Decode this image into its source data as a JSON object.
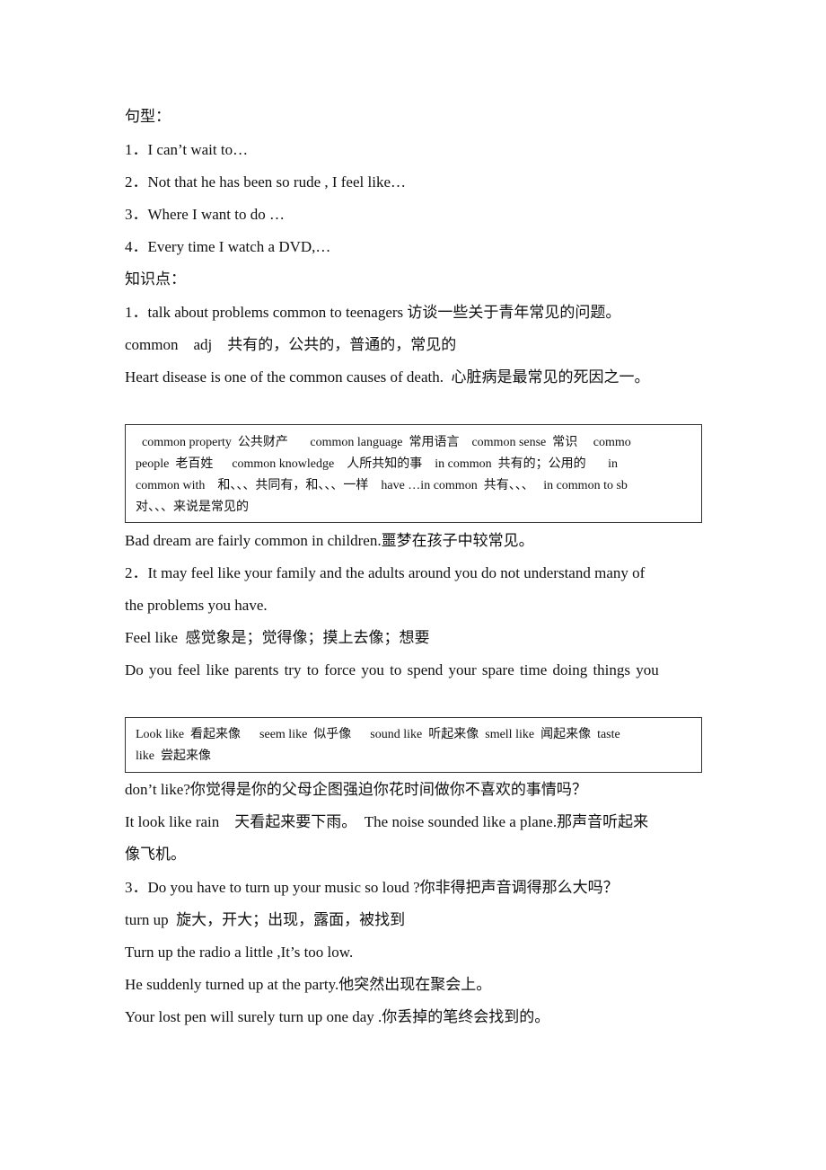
{
  "heading_patterns": "句型：",
  "patterns": [
    "1．I can’t wait to…",
    "2．Not that he has been so rude , I feel like…",
    "3．Where I want to do …",
    "4．Every time I watch a DVD,…"
  ],
  "heading_points": "知识点：",
  "point1": {
    "title": "1．talk about problems common to teenagers 访谈一些关于青年常见的问题。",
    "definition": "common    adj    共有的，公共的，普通的，常见的",
    "example": "Heart disease is one of the common causes of death.  心脏病是最常见的死因之一。",
    "box_lines": [
      "  common property  公共财产       common language  常用语言    common sense  常识     commo",
      "people  老百姓      common knowledge    人所共知的事    in common  共有的；公用的       in",
      "common with    和、、、共同有，和、、、一样    have …in common  共有、、、   in common to sb",
      "对、、、来说是常见的"
    ],
    "example2": "Bad dream are fairly common in children.噩梦在孩子中较常见。"
  },
  "point2": {
    "title_line1": "2．It may feel like your family and the adults around you do not understand many of",
    "title_line2": "the problems you have.",
    "definition": "Feel like  感觉象是；觉得像；摸上去像；想要",
    "example_line1": "Do you feel like parents try to force you to spend your spare time doing things you",
    "box_lines": [
      "Look like  看起来像      seem like  似乎像      sound like  听起来像  smell like  闻起来像  taste",
      "like  尝起来像"
    ],
    "example_line2": "don’t like?你觉得是你的父母企图强迫你花时间做你不喜欢的事情吗？",
    "example3_line1": "It look like rain    天看起来要下雨。  The noise sounded like a plane.那声音听起来",
    "example3_line2": "像飞机。"
  },
  "point3": {
    "title": "3．Do you have to turn up your music so loud ?你非得把声音调得那么大吗？",
    "definition": "turn up  旋大，开大；出现，露面，被找到",
    "examples": [
      "Turn up the radio a little ,It’s too low.",
      "He suddenly turned up at the party.他突然出现在聚会上。",
      "Your lost pen will surely turn up one day .你丢掉的笔终会找到的。"
    ]
  }
}
